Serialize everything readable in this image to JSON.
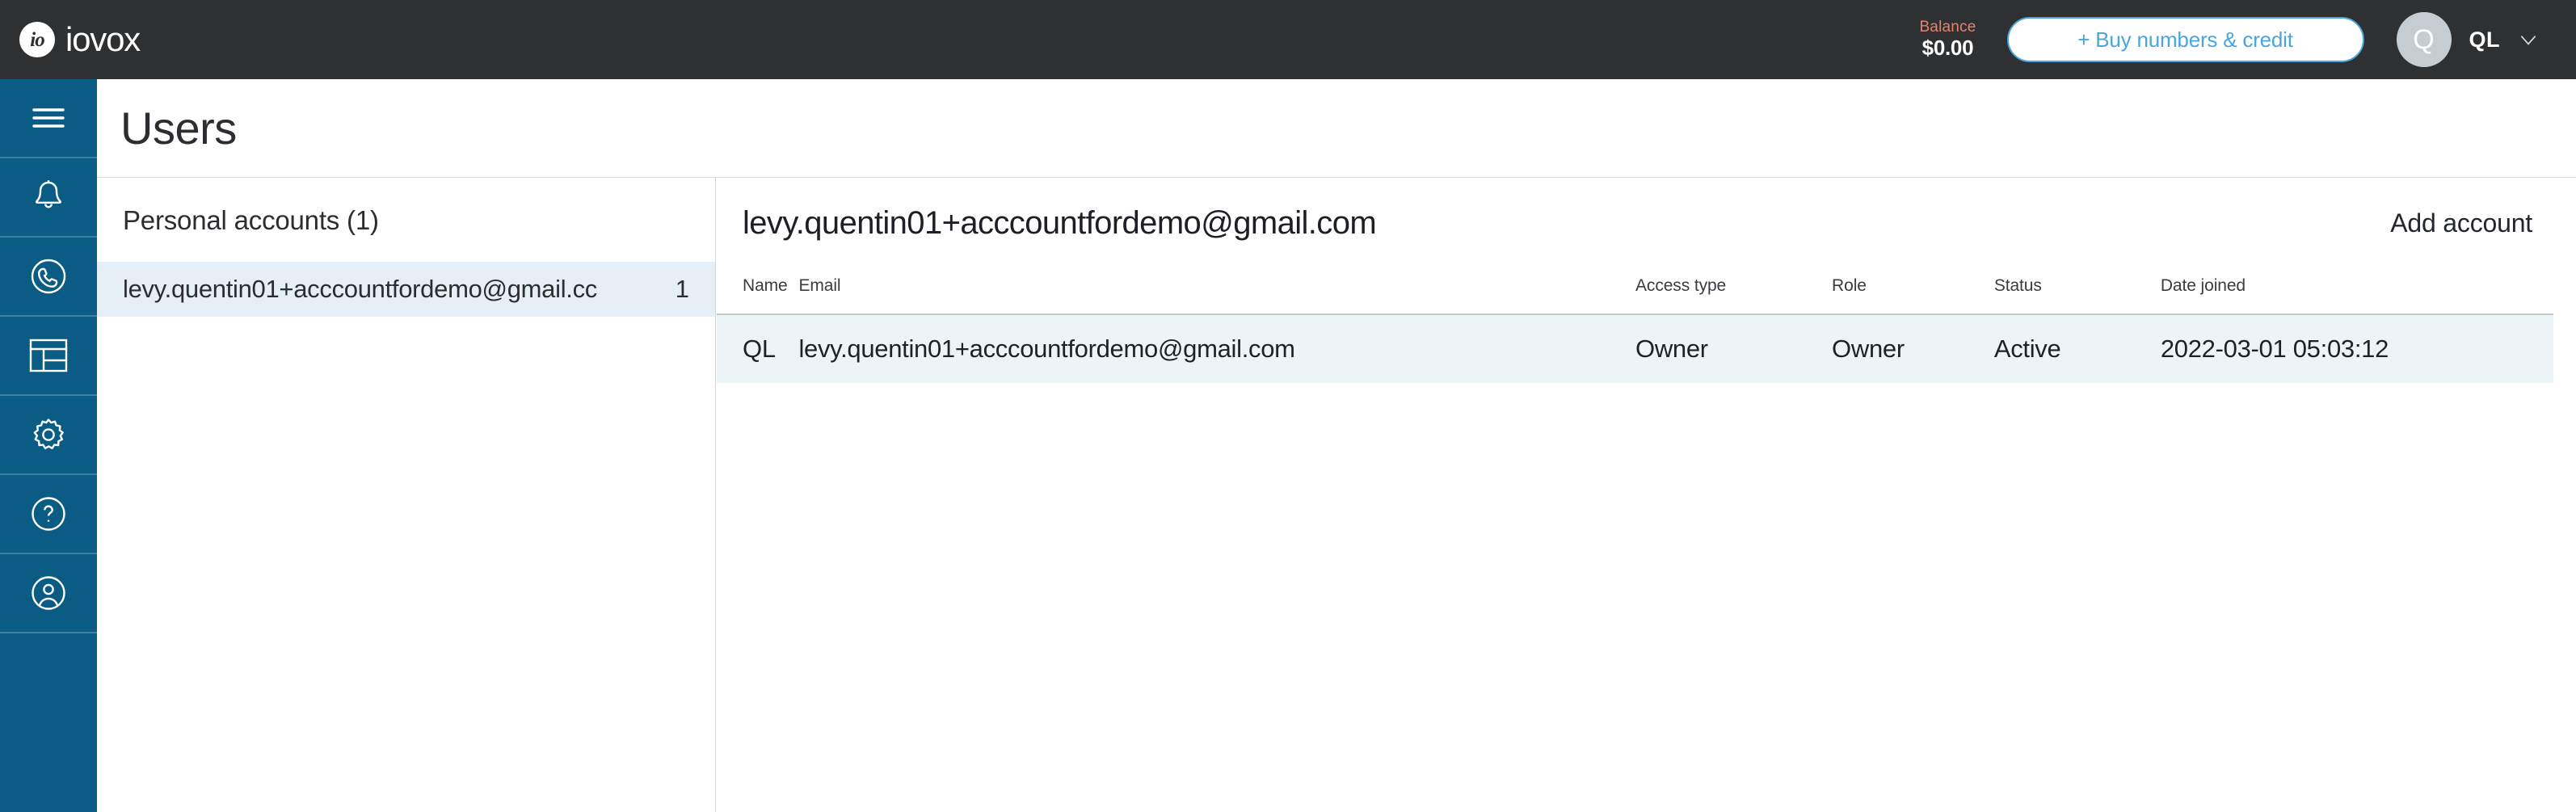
{
  "topbar": {
    "brand_mark": "io",
    "brand_name": "iovox",
    "balance_label": "Balance",
    "balance_amount": "$0.00",
    "buy_button_label": "+ Buy numbers & credit",
    "avatar_initial": "Q",
    "user_initials": "QL",
    "accent_blue": "#46a6dd",
    "accent_orange": "#e8836b",
    "bar_background": "#2f3032"
  },
  "rail": {
    "background": "#0b5c84",
    "items": [
      {
        "icon": "hamburger-menu-icon",
        "name": "menu"
      },
      {
        "icon": "bell-icon",
        "name": "notifications"
      },
      {
        "icon": "phone-circle-icon",
        "name": "calls"
      },
      {
        "icon": "layout-icon",
        "name": "dashboard"
      },
      {
        "icon": "gear-icon",
        "name": "settings"
      },
      {
        "icon": "question-circle-icon",
        "name": "help"
      },
      {
        "icon": "user-circle-icon",
        "name": "account"
      }
    ]
  },
  "page": {
    "title": "Users"
  },
  "accounts_panel": {
    "heading": "Personal accounts (1)",
    "rows": [
      {
        "email": "levy.quentin01+acccountfordemo@gmail.cc",
        "count": "1",
        "selected": true,
        "highlight_color": "#e6eff6"
      }
    ]
  },
  "main": {
    "title": "levy.quentin01+acccountfordemo@gmail.com",
    "add_account_label": "Add account",
    "table": {
      "columns": [
        "Name",
        "Email",
        "Access type",
        "Role",
        "Status",
        "Date joined"
      ],
      "rows": [
        {
          "name": "QL",
          "email": "levy.quentin01+acccountfordemo@gmail.com",
          "access_type": "Owner",
          "role": "Owner",
          "status": "Active",
          "date_joined": "2022-03-01 05:03:12",
          "row_color": "#edf4f7"
        }
      ]
    }
  }
}
